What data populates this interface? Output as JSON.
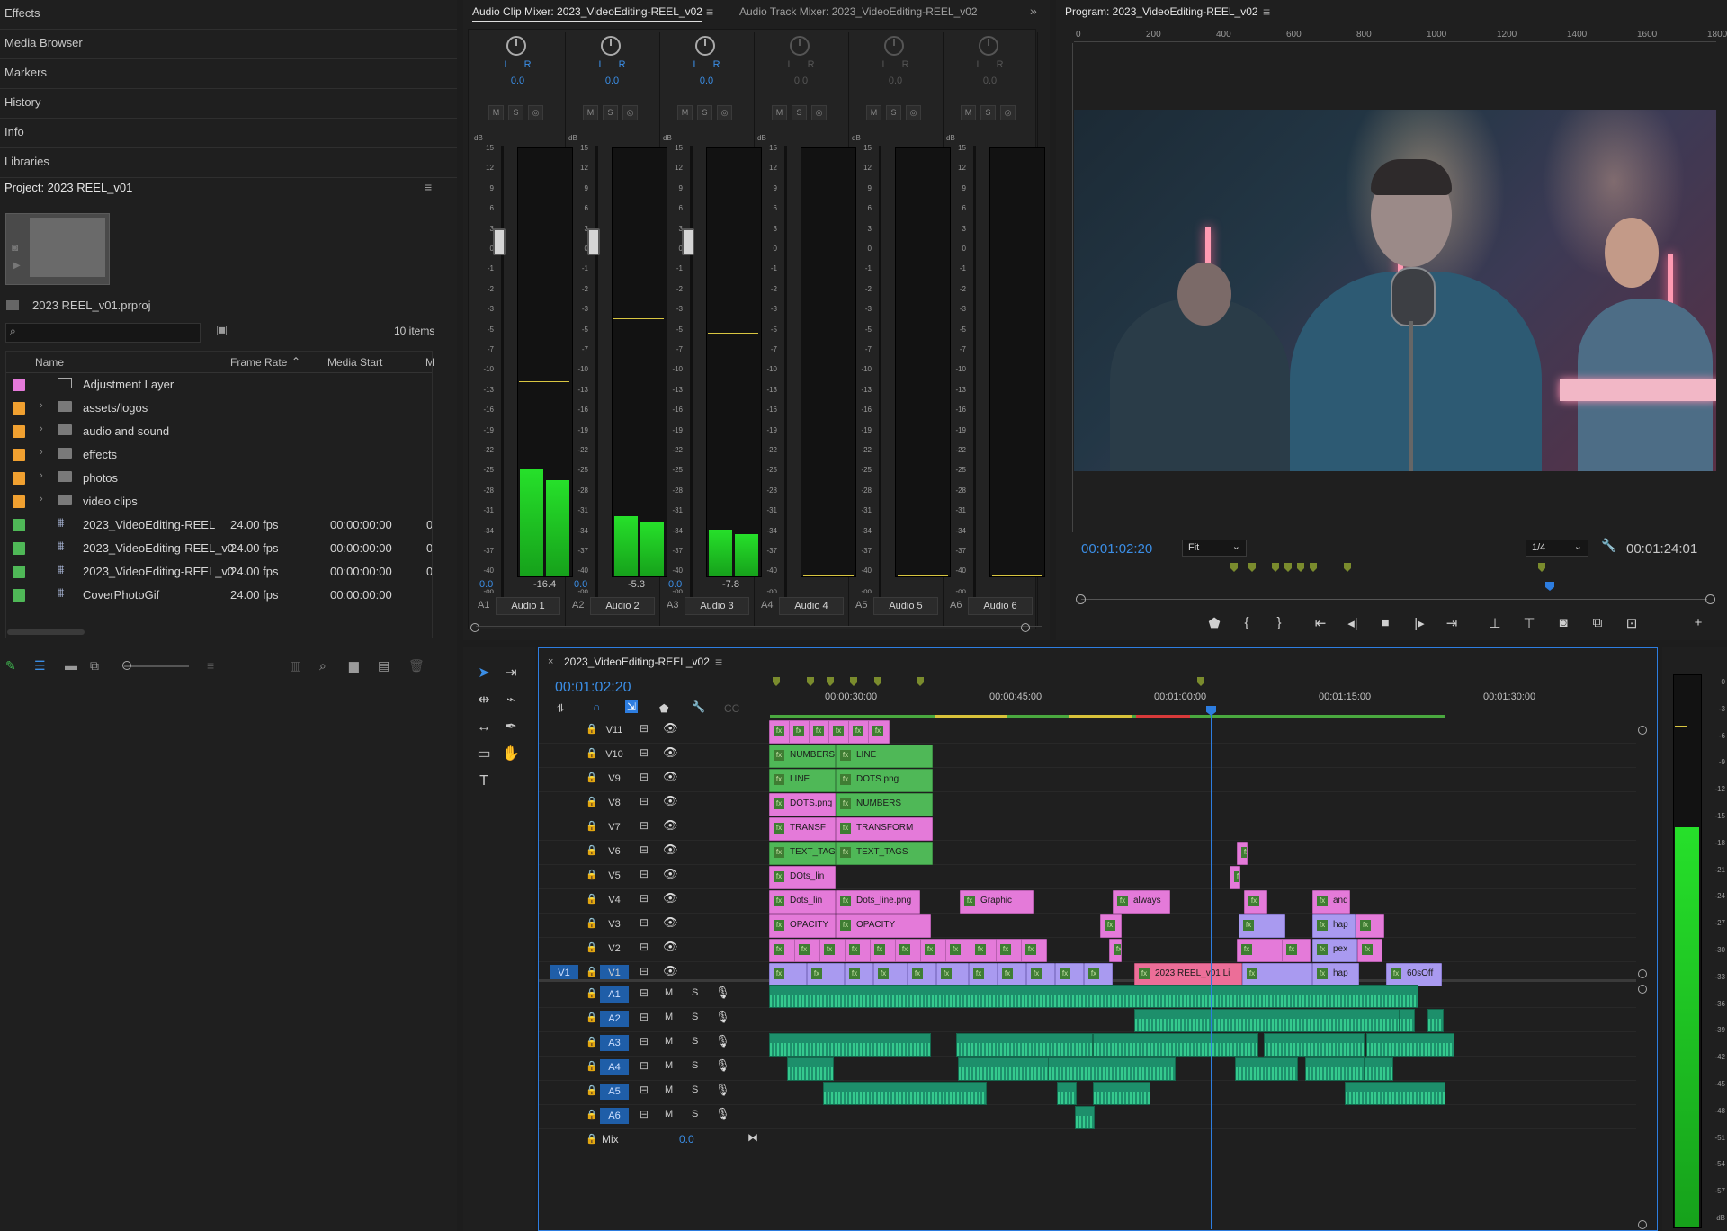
{
  "left_panel": {
    "tabs": [
      "Effects",
      "Media Browser",
      "Markers",
      "History",
      "Info",
      "Libraries"
    ],
    "project_title": "Project: 2023 REEL_v01",
    "project_file": "2023 REEL_v01.prproj",
    "search_placeholder": "",
    "item_count": "10 items",
    "columns": [
      "Name",
      "Frame Rate",
      "Media Start",
      "M"
    ],
    "rows": [
      {
        "name": "Adjustment Layer",
        "frame_rate": "",
        "media_start": "",
        "color": "#e47ad9",
        "type": "adjustment"
      },
      {
        "name": "assets/logos",
        "frame_rate": "",
        "media_start": "",
        "color": "#f0a030",
        "type": "folder"
      },
      {
        "name": "audio and sound",
        "frame_rate": "",
        "media_start": "",
        "color": "#f0a030",
        "type": "folder"
      },
      {
        "name": "effects",
        "frame_rate": "",
        "media_start": "",
        "color": "#f0a030",
        "type": "folder"
      },
      {
        "name": "photos",
        "frame_rate": "",
        "media_start": "",
        "color": "#f0a030",
        "type": "folder"
      },
      {
        "name": "video clips",
        "frame_rate": "",
        "media_start": "",
        "color": "#f0a030",
        "type": "folder"
      },
      {
        "name": "2023_VideoEditing-REEL",
        "frame_rate": "24.00 fps",
        "media_start": "00:00:00:00",
        "cut": "0",
        "color": "#4fb857",
        "type": "sequence"
      },
      {
        "name": "2023_VideoEditing-REEL_v0",
        "frame_rate": "24.00 fps",
        "media_start": "00:00:00:00",
        "cut": "0",
        "color": "#4fb857",
        "type": "sequence"
      },
      {
        "name": "2023_VideoEditing-REEL_v0",
        "frame_rate": "24.00 fps",
        "media_start": "00:00:00:00",
        "cut": "0",
        "color": "#4fb857",
        "type": "sequence"
      },
      {
        "name": "CoverPhotoGif",
        "frame_rate": "24.00 fps",
        "media_start": "00:00:00:00",
        "cut": "",
        "color": "#4fb857",
        "type": "sequence"
      }
    ]
  },
  "mixer": {
    "tab_active": "Audio Clip Mixer: 2023_VideoEditing-REEL_v02",
    "tab_inactive": "Audio Track Mixer: 2023_VideoEditing-REEL_v02",
    "overflow_icon": "»",
    "db_label": "dB",
    "scale": [
      "15",
      "12",
      "9",
      "6",
      "3",
      "0",
      "-1",
      "-2",
      "-3",
      "-5",
      "-7",
      "-10",
      "-13",
      "-16",
      "-19",
      "-22",
      "-25",
      "-28",
      "-31",
      "-34",
      "-37",
      "-40",
      "-oo"
    ],
    "channels": [
      {
        "id": "A1",
        "name": "Audio 1",
        "pan": "0.0",
        "left_val": "0.0",
        "peak": "-16.4",
        "level": 0.25,
        "active": true
      },
      {
        "id": "A2",
        "name": "Audio 2",
        "pan": "0.0",
        "left_val": "0.0",
        "peak": "-5.3",
        "level": 0.14,
        "active": true
      },
      {
        "id": "A3",
        "name": "Audio 3",
        "pan": "0.0",
        "left_val": "0.0",
        "peak": "-7.8",
        "level": 0.11,
        "active": true
      },
      {
        "id": "A4",
        "name": "Audio 4",
        "pan": "0.0",
        "left_val": "",
        "peak": "",
        "level": 0,
        "active": false
      },
      {
        "id": "A5",
        "name": "Audio 5",
        "pan": "0.0",
        "left_val": "",
        "peak": "",
        "level": 0,
        "active": false
      },
      {
        "id": "A6",
        "name": "Audio 6",
        "pan": "0.0",
        "left_val": "",
        "peak": "",
        "level": 0,
        "active": false
      }
    ],
    "msr": [
      "M",
      "S",
      "◎"
    ],
    "lr": [
      "L",
      "R"
    ]
  },
  "program": {
    "title": "Program: 2023_VideoEditing-REEL_v02",
    "ruler": [
      "0",
      "200",
      "400",
      "600",
      "800",
      "1000",
      "1200",
      "1400",
      "1600",
      "1800"
    ],
    "timecode": "00:01:02:20",
    "zoom": "Fit",
    "resolution": "1/4",
    "duration": "00:01:24:01"
  },
  "timeline": {
    "sequence_name": "2023_VideoEditing-REEL_v02",
    "timecode": "00:01:02:20",
    "ruler": [
      "00:00:30:00",
      "00:00:45:00",
      "00:01:00:00",
      "00:01:15:00",
      "00:01:30:00"
    ],
    "video_tracks": [
      "V11",
      "V10",
      "V9",
      "V8",
      "V7",
      "V6",
      "V5",
      "V4",
      "V3",
      "V2",
      "V1"
    ],
    "audio_tracks": [
      "A1",
      "A2",
      "A3",
      "A4",
      "A5",
      "A6"
    ],
    "source_patch": "V1",
    "mix_label": "Mix",
    "mix_value": "0.0",
    "track_buttons": [
      "M",
      "S"
    ],
    "clips": {
      "v10_a": "NUMBERS",
      "v10_b": "LINE",
      "v9_a": "LINE",
      "v9_b": "DOTS.png",
      "v8_a": "DOTS.png",
      "v8_b": "NUMBERS",
      "v7_a": "TRANSF",
      "v7_b": "TRANSFORM",
      "v6_a": "TEXT_TAGS",
      "v6_b": "TEXT_TAGS",
      "v5_a": "DOts_lin",
      "v4_a": "Dots_lin",
      "v4_b": "Dots_line.png",
      "v4_c": "Graphic",
      "v4_d": "always",
      "v4_e": "and",
      "v3_a": "OPACITY",
      "v3_b": "OPACITY",
      "v3_c": "hap",
      "v2_a": "pex",
      "v1_a": "2023 REEL_v01 Li",
      "v1_b": "hap",
      "v1_c": "60sOff"
    },
    "master_scale": [
      "0",
      "-3",
      "-6",
      "-9",
      "-12",
      "-15",
      "-18",
      "-21",
      "-24",
      "-27",
      "-30",
      "-33",
      "-36",
      "-39",
      "-42",
      "-45",
      "-48",
      "-51",
      "-54",
      "-57",
      "dB"
    ]
  }
}
